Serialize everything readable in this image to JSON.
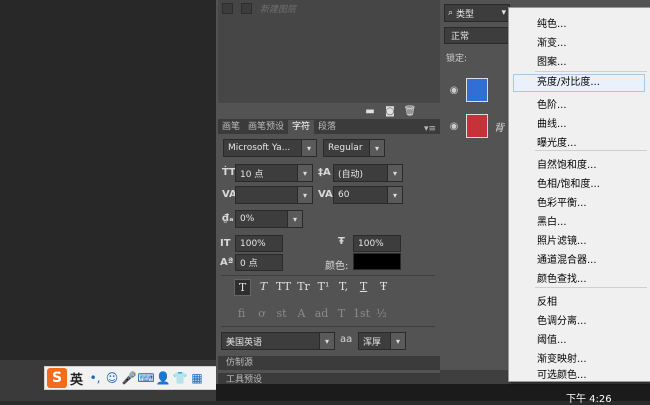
{
  "actions_panel": {
    "new_action_label": "新建图层"
  },
  "panel_tabs": [
    "画笔",
    "画笔预设",
    "字符",
    "段落"
  ],
  "character": {
    "font_family": "Microsoft Ya...",
    "font_style": "Regular",
    "font_size": "10 点",
    "leading": "(自动)",
    "kerning": "",
    "tracking": "60",
    "vertical_scale_pct": "0%",
    "horizontal_scale": "100%",
    "vertical_scale": "100%",
    "baseline_shift": "0 点",
    "color_label": "颜色:",
    "text_color": "#000000",
    "language": "美国英语",
    "aa_label": "aa",
    "antialias": "浑厚",
    "style_buttons": [
      "T",
      "T",
      "TT",
      "Tr",
      "T¹",
      "T,",
      "T",
      "Ŧ"
    ],
    "opentype_buttons": [
      "fi",
      "ơ",
      "st",
      "A",
      "ad",
      "T",
      "1st",
      "½"
    ]
  },
  "bottom_panels": {
    "clone_source": "仿制源",
    "tool_presets": "工具预设"
  },
  "layers": {
    "filter_label": "类型",
    "blend_mode": "正常",
    "lock_label": "锁定:",
    "rows": [
      {
        "name": "",
        "thumb_color": "#2f6fd6"
      },
      {
        "name": "背",
        "thumb_color": "#c7323a"
      }
    ]
  },
  "adjust_menu": {
    "groups": [
      [
        "纯色...",
        "渐变...",
        "图案..."
      ],
      [
        "亮度/对比度...",
        "色阶...",
        "曲线...",
        "曝光度..."
      ],
      [
        "自然饱和度...",
        "色相/饱和度...",
        "色彩平衡...",
        "黑白...",
        "照片滤镜...",
        "通道混合器...",
        "颜色查找..."
      ],
      [
        "反相",
        "色调分离...",
        "阈值...",
        "渐变映射...",
        "可选颜色..."
      ]
    ]
  },
  "ime": {
    "logo": "S",
    "mode": "英"
  },
  "taskbar": {
    "clock": "下午 4:26"
  }
}
